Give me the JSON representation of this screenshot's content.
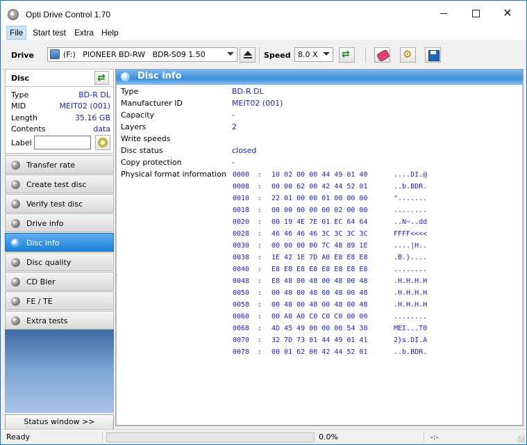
{
  "window": {
    "title": "Opti Drive Control 1.70"
  },
  "menu": [
    {
      "label": "File",
      "selected": true
    },
    {
      "label": "Start test",
      "selected": false
    },
    {
      "label": "Extra",
      "selected": false
    },
    {
      "label": "Help",
      "selected": false
    }
  ],
  "toolbar": {
    "drive_label": "Drive",
    "drive_value": "(F:)   PIONEER BD-RW   BDR-S09 1.50",
    "speed_label": "Speed",
    "speed_value": "8.0 X"
  },
  "disc": {
    "header": "Disc",
    "rows": [
      {
        "key": "Type",
        "value": "BD-R DL"
      },
      {
        "key": "MID",
        "value": "MEIT02 (001)"
      },
      {
        "key": "Length",
        "value": "35.16 GB"
      },
      {
        "key": "Contents",
        "value": "data"
      }
    ],
    "label_key": "Label",
    "label_value": ""
  },
  "nav": [
    {
      "label": "Transfer rate",
      "active": false
    },
    {
      "label": "Create test disc",
      "active": false
    },
    {
      "label": "Verify test disc",
      "active": false
    },
    {
      "label": "Drive info",
      "active": false
    },
    {
      "label": "Disc info",
      "active": true
    },
    {
      "label": "Disc quality",
      "active": false
    },
    {
      "label": "CD Bler",
      "active": false
    },
    {
      "label": "FE / TE",
      "active": false
    },
    {
      "label": "Extra tests",
      "active": false
    }
  ],
  "status_window_label": "Status window >>",
  "panel": {
    "title": "Disc info",
    "rows": [
      {
        "key": "Type",
        "value": "BD-R DL"
      },
      {
        "key": "Manufacturer ID",
        "value": "MEIT02 (001)"
      },
      {
        "key": "Capacity",
        "value": "-"
      },
      {
        "key": "Layers",
        "value": "2"
      },
      {
        "key": "Write speeds",
        "value": ""
      },
      {
        "key": "Disc status",
        "value": "closed"
      },
      {
        "key": "Copy protection",
        "value": "-"
      },
      {
        "key": "Physical format information",
        "value": ""
      }
    ],
    "hex": [
      {
        "offset": "0000",
        "bytes": "10 02 00 00 44 49 01 40",
        "ascii": "....DI.@"
      },
      {
        "offset": "0008",
        "bytes": "00 00 62 00 42 44 52 01",
        "ascii": "..b.BDR."
      },
      {
        "offset": "0010",
        "bytes": "22 01 00 00 01 00 00 00",
        "ascii": "\"......."
      },
      {
        "offset": "0018",
        "bytes": "00 00 00 00 00 02 00 00",
        "ascii": "........"
      },
      {
        "offset": "0020",
        "bytes": "00 19 4E 7E 01 EC 64 64",
        "ascii": "..N~..dd"
      },
      {
        "offset": "0028",
        "bytes": "46 46 46 46 3C 3C 3C 3C",
        "ascii": "FFFF<<<<"
      },
      {
        "offset": "0030",
        "bytes": "00 00 00 00 7C 48 89 1E",
        "ascii": "....|H.."
      },
      {
        "offset": "0038",
        "bytes": "1E 42 1E 7D A0 E8 E8 E8",
        "ascii": ".B.}...."
      },
      {
        "offset": "0040",
        "bytes": "E8 E8 E8 E8 E8 E8 E8 E8",
        "ascii": "........"
      },
      {
        "offset": "0048",
        "bytes": "E8 48 00 48 00 48 00 48",
        "ascii": ".H.H.H.H"
      },
      {
        "offset": "0050",
        "bytes": "00 48 00 48 00 48 00 48",
        "ascii": ".H.H.H.H"
      },
      {
        "offset": "0058",
        "bytes": "00 48 00 48 00 48 00 48",
        "ascii": ".H.H.H.H"
      },
      {
        "offset": "0060",
        "bytes": "00 A0 A0 C0 C0 C0 00 00",
        "ascii": "........"
      },
      {
        "offset": "0068",
        "bytes": "4D 45 49 00 00 00 54 30",
        "ascii": "MEI...T0"
      },
      {
        "offset": "0070",
        "bytes": "32 7D 73 01 44 49 01 41",
        "ascii": "2}s.DI.A"
      },
      {
        "offset": "0078",
        "bytes": "00 01 62 00 42 44 52 01",
        "ascii": "..b.BDR."
      }
    ],
    "hex_separator": ":"
  },
  "status": {
    "ready": "Ready",
    "percent": "0.0%",
    "time": "-:-",
    "progress": 0
  }
}
